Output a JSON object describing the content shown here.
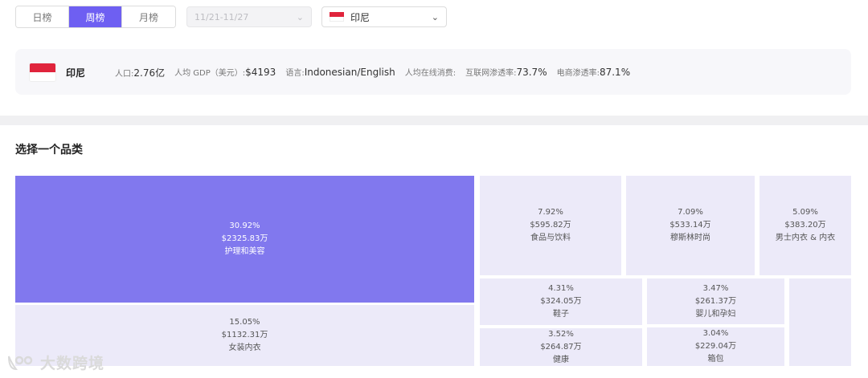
{
  "period_tabs": [
    "日榜",
    "周榜",
    "月榜"
  ],
  "active_tab_index": 1,
  "date_range": "11/21-11/27",
  "country_select": {
    "label": "印尼"
  },
  "info": {
    "country": "印尼",
    "population_label": "人口:",
    "population_value": "2.76亿",
    "gdp_label": "人均 GDP（美元）:",
    "gdp_value": "$4193",
    "language_label": "语言:",
    "language_value": "Indonesian/English",
    "online_spend_label": "人均在线消费:",
    "online_spend_value": "",
    "internet_label": "互联网渗透率:",
    "internet_value": "73.7%",
    "ecommerce_label": "电商渗透率:",
    "ecommerce_value": "87.1%"
  },
  "section_title": "选择一个品类",
  "categories": [
    {
      "pct": "30.92%",
      "amount": "$2325.83万",
      "name": "护理和美容"
    },
    {
      "pct": "15.05%",
      "amount": "$1132.31万",
      "name": "女装内衣"
    },
    {
      "pct": "7.92%",
      "amount": "$595.82万",
      "name": "食品与饮料"
    },
    {
      "pct": "7.09%",
      "amount": "$533.14万",
      "name": "穆斯林时尚"
    },
    {
      "pct": "5.09%",
      "amount": "$383.20万",
      "name": "男士内衣 & 内衣"
    },
    {
      "pct": "4.31%",
      "amount": "$324.05万",
      "name": "鞋子"
    },
    {
      "pct": "3.52%",
      "amount": "$264.87万",
      "name": "健康"
    },
    {
      "pct": "3.47%",
      "amount": "$261.37万",
      "name": "婴儿和孕妇"
    },
    {
      "pct": "3.04%",
      "amount": "$229.04万",
      "name": "箱包"
    }
  ],
  "watermark": "大数跨境",
  "colors": {
    "accent": "#6e5ff2",
    "primary_tile": "#8178ee",
    "tile": "#eceaf9",
    "flag_red": "#e0243c"
  }
}
